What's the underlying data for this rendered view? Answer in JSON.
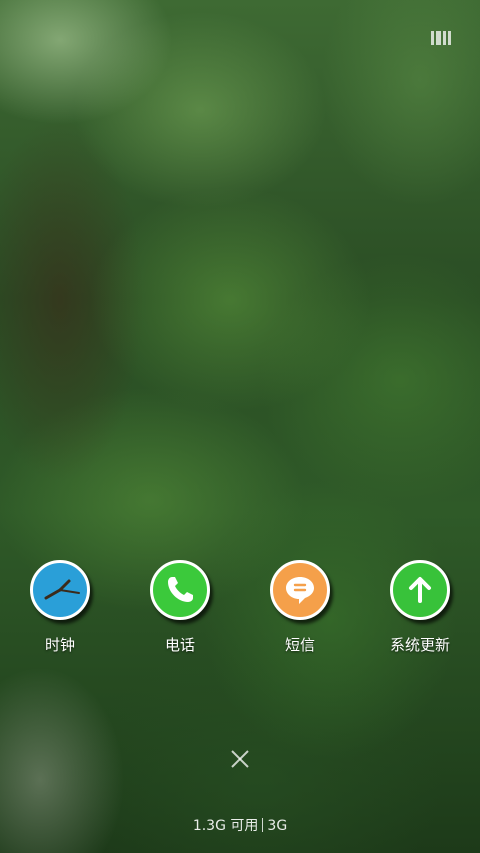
{
  "apps": [
    {
      "label": "时钟",
      "icon": "clock-icon",
      "color": "#2a9fd8"
    },
    {
      "label": "电话",
      "icon": "phone-icon",
      "color": "#3bc93b"
    },
    {
      "label": "短信",
      "icon": "message-icon",
      "color": "#f5a04a"
    },
    {
      "label": "系统更新",
      "icon": "arrow-up-icon",
      "color": "#38c23a"
    }
  ],
  "memory": {
    "available": "1.3G 可用",
    "total": "3G"
  },
  "close_icon": "close-icon",
  "status_icon": "battery-icon"
}
